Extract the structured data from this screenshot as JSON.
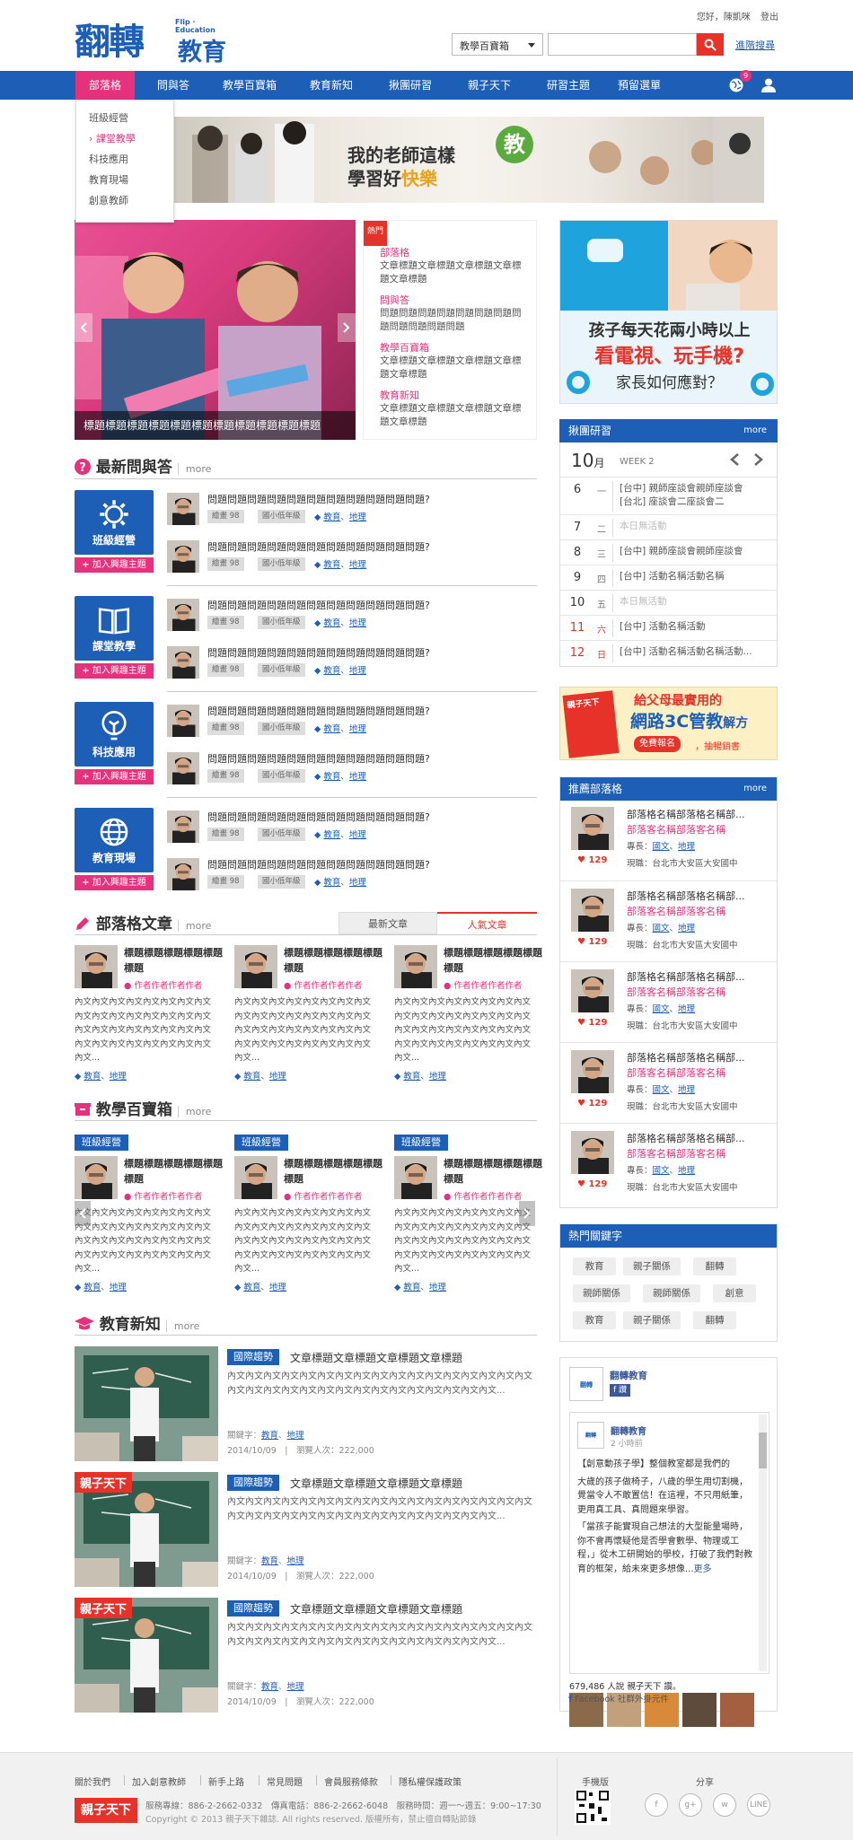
{
  "header": {
    "logo_main": "翻轉",
    "logo_sub": "教育",
    "logo_en": "Flip · Education",
    "greeting": "您好，陳凱咪",
    "logout": "登出",
    "search_select": "教學百寶箱",
    "advanced_search": "進階搜尋"
  },
  "nav": {
    "items": [
      "部落格",
      "問與答",
      "教學百寶箱",
      "教育新知",
      "揪團研習",
      "親子天下",
      "研習主題",
      "預留選單"
    ],
    "notification_count": "9",
    "dropdown": [
      "班級經營",
      "課堂教學",
      "科技應用",
      "教育現場",
      "創意教師"
    ]
  },
  "banner": {
    "line1": "我的老師這樣",
    "circle": "教",
    "line2a": "學習好",
    "line2b": "快樂"
  },
  "carousel": {
    "caption": "標題標題標題標題標題標題標題標題標題標題標題"
  },
  "hot": {
    "flag": "熱門",
    "items": [
      {
        "cat": "部落格",
        "text": "文章標題文章標題文章標題文章標題文章標題"
      },
      {
        "cat": "問與答",
        "text": "問題問題問題問題問題問題問題問題問題問題問題問題"
      },
      {
        "cat": "教學百寶箱",
        "text": "文章標題文章標題文章標題文章標題文章標題"
      },
      {
        "cat": "教育新知",
        "text": "文章標題文章標題文章標題文章標題文章標題"
      }
    ]
  },
  "qa": {
    "title": "最新問與答",
    "more": "more",
    "add_label": "加入興趣主題",
    "question": "問題問題問題問題問題問題問題問題問題問題問題?",
    "tag1": "繪畫 98",
    "tag2": "國小低年級",
    "cats_a": "教育",
    "cats_b": "地理",
    "groups": [
      {
        "label": "班級經營"
      },
      {
        "label": "課堂教學"
      },
      {
        "label": "科技應用"
      },
      {
        "label": "教育現場"
      }
    ]
  },
  "blog": {
    "title": "部落格文章",
    "more": "more",
    "tab_new": "最新文章",
    "tab_hot": "人氣文章",
    "card_title": "標題標題標題標題標題標題",
    "author": "作者作者作者作者",
    "body": "內文內文內文內文內文內文內文內文內文內文內文內文內文內文內文內文內文內文內文內文內文內文內文內文內文內文內文內文內文內文內文內文內文...",
    "cat_a": "教育",
    "cat_b": "地理"
  },
  "toolbox": {
    "title": "教學百寶箱",
    "more": "more",
    "badge": "班級經營"
  },
  "news": {
    "title": "教育新知",
    "more": "more",
    "badge": "國際趨勢",
    "item_title": "文章標題文章標題文章標題文章標題",
    "text": "內文內文內文內文內文內文內文內文內文內文內文內文內文內文內文內文內文內文內文內文內文內文內文內文內文內文內文內文內文內文內文內文...",
    "kw_label": "關鍵字：",
    "kw_a": "教育",
    "kw_b": "地理",
    "date": "2014/10/09",
    "views": "瀏覽人次：222,000",
    "img_label": "親子天下"
  },
  "promo": {
    "l1": "孩子每天花兩小時以上",
    "l2": "看電視、玩手機?",
    "l3": "家長如何應對？"
  },
  "calendar": {
    "title": "揪團研習",
    "more": "more",
    "month": "10",
    "month_unit": "月",
    "week": "WEEK 2",
    "rows": [
      {
        "d": "6",
        "w": "一",
        "e": [
          "[台中] 親師座談會親師座談會",
          "[台北] 座談會二座談會二"
        ]
      },
      {
        "d": "7",
        "w": "二",
        "e": [
          "本日無活動"
        ]
      },
      {
        "d": "8",
        "w": "三",
        "e": [
          "[台中] 親師座談會親師座談會"
        ]
      },
      {
        "d": "9",
        "w": "四",
        "e": [
          "[台中] 活動名稱活動名稱"
        ]
      },
      {
        "d": "10",
        "w": "五",
        "e": [
          "本日無活動"
        ]
      },
      {
        "d": "11",
        "w": "六",
        "e": [
          "[台中] 活動名稱活動"
        ]
      },
      {
        "d": "12",
        "w": "日",
        "e": [
          "[台中] 活動名稱活動名稱活動..."
        ]
      }
    ]
  },
  "ad2": {
    "l1": "給父母最實用的",
    "l2": "網路3C管教",
    "l2b": "解方",
    "btn": "免費報名",
    "l3": "，抽暢銷書",
    "book": "親子天下"
  },
  "bloggers": {
    "title": "推薦部落格",
    "more": "more",
    "name": "部落格名稱部落格名稱部...",
    "sub": "部落客名稱部落客名稱",
    "spec_label": "專長：",
    "spec_a": "國文",
    "spec_b": "地理",
    "loc": "現職：台北市大安區大安國中",
    "likes": "129"
  },
  "tags": {
    "title": "熱門關鍵字",
    "items": [
      "教育",
      "親子關係",
      "翻轉",
      "親師關係",
      "親師關係",
      "創意",
      "教育",
      "親子關係",
      "翻轉"
    ]
  },
  "fb": {
    "page": "翻轉教育",
    "like": "讚",
    "post_name": "翻轉教育",
    "post_time": "2 小時前",
    "post_text1": "【創意動孩子學】整個教室都是我們的",
    "post_text2": "大歲的孩子做椅子，八歲的學生用切割機，覺當令人不敢置信！在這裡，不只用紙筆，更用真工具、真問題來學習。",
    "post_text3": "「當孩子能實現自己想法的大型能量場時，你不會再懷疑他是否學會數學、物理或工程，」從木工研開始的學校，打破了我們對教育的框架，給未來更多想像...",
    "post_more": "更多",
    "count": "679,486 人說 親子天下 讚。",
    "plugin": "Facebook 社群外掛元件"
  },
  "footer": {
    "links": [
      "關於我們",
      "加入創意教師",
      "新手上路",
      "常見問題",
      "會員服務條款",
      "隱私權保護政策"
    ],
    "mobile": "手機版",
    "share": "分享",
    "logo": "親子天下",
    "contact": "服務專線：886-2-2662-0332　傳真電話：886-2-2662-6048　服務時間：週一～週五：9:00~17:30",
    "copyright": "Copyright © 2013 親子天下雜誌. All rights reserved. 版權所有，禁止擅自轉貼節錄",
    "share_icons": [
      "f",
      "g+",
      "w",
      "LINE"
    ]
  }
}
